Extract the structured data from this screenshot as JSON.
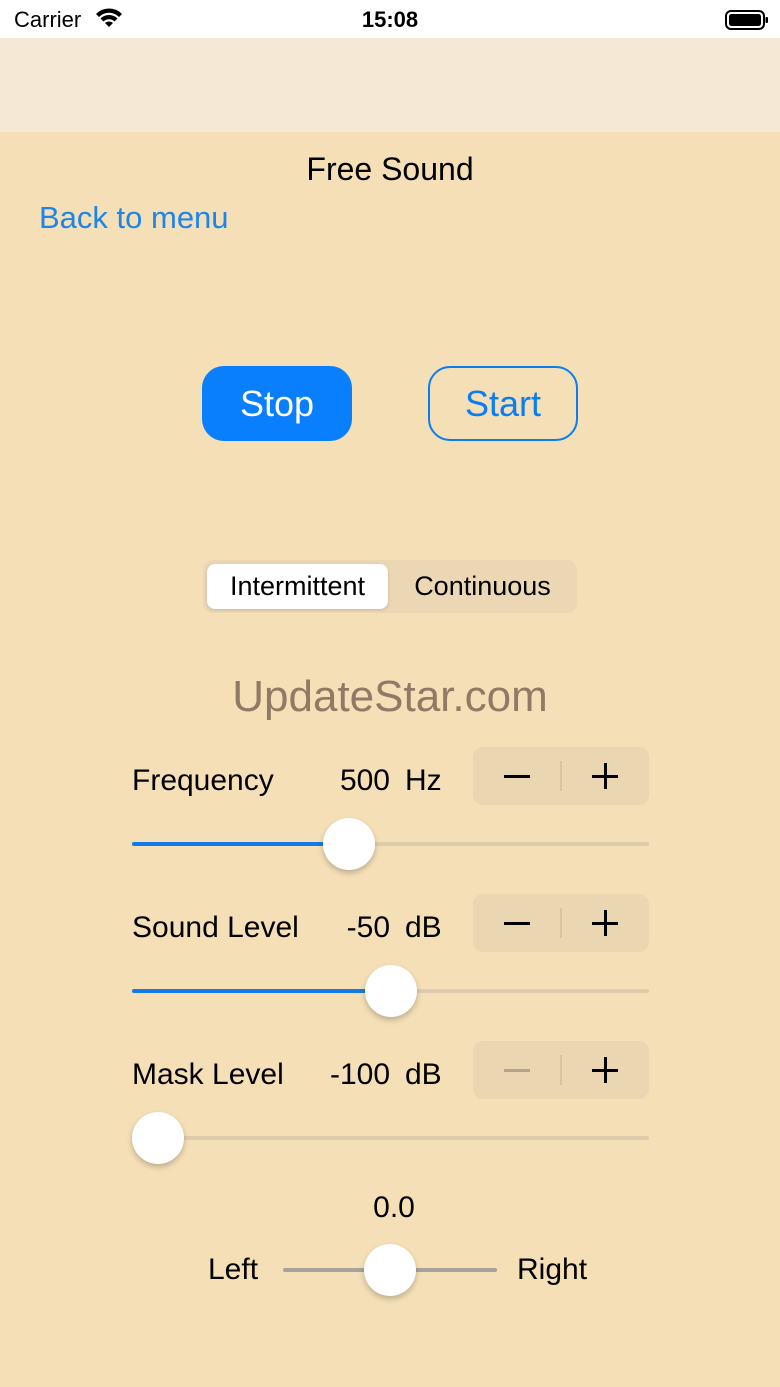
{
  "status_bar": {
    "carrier": "Carrier",
    "time": "15:08",
    "wifi_icon": "wifi-icon",
    "battery_icon": "battery-icon"
  },
  "header": {
    "title": "Free Sound",
    "back_label": "Back to menu"
  },
  "controls": {
    "stop_label": "Stop",
    "start_label": "Start"
  },
  "mode": {
    "options": [
      "Intermittent",
      "Continuous"
    ],
    "selected": "Intermittent"
  },
  "watermark": "UpdateStar.com",
  "frequency": {
    "label": "Frequency",
    "value": "500",
    "unit": "Hz",
    "slider_fraction": 0.41
  },
  "sound_level": {
    "label": "Sound Level",
    "value": "-50",
    "unit": "dB",
    "slider_fraction": 0.5
  },
  "mask_level": {
    "label": "Mask Level",
    "value": "-100",
    "unit": "dB",
    "slider_fraction": 0.0
  },
  "balance": {
    "value": "0.0",
    "left_label": "Left",
    "right_label": "Right",
    "slider_fraction": 0.5
  },
  "colors": {
    "background": "#f4dfb6",
    "accent": "#097ffd",
    "link": "#1d84ea"
  }
}
